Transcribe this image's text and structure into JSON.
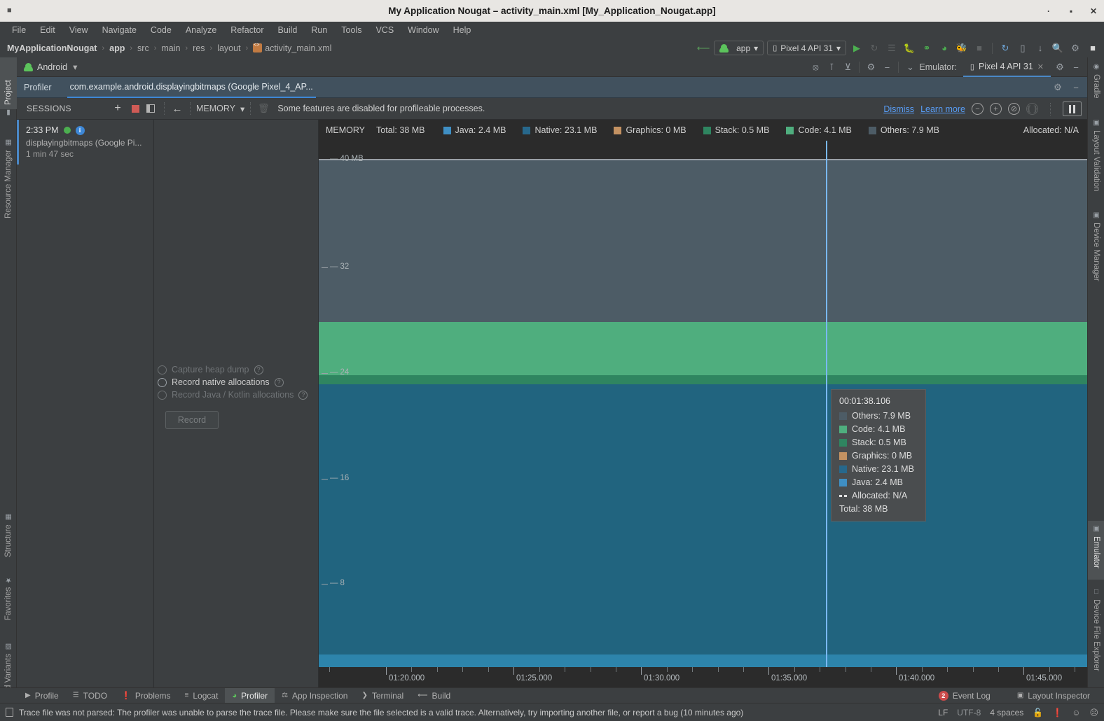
{
  "window": {
    "title": "My Application Nougat – activity_main.xml [My_Application_Nougat.app]",
    "minimize": "·",
    "maximize": "▪",
    "close": "✕"
  },
  "menubar": {
    "items": [
      "File",
      "Edit",
      "View",
      "Navigate",
      "Code",
      "Analyze",
      "Refactor",
      "Build",
      "Run",
      "Tools",
      "VCS",
      "Window",
      "Help"
    ]
  },
  "breadcrumb": {
    "items": [
      "MyApplicationNougat",
      "app",
      "src",
      "main",
      "res",
      "layout",
      "activity_main.xml"
    ],
    "separator": "›"
  },
  "run_toolbar": {
    "module_label": "app",
    "device_label": "Pixel 4 API 31",
    "icons": [
      "hammer-icon",
      "run-icon",
      "run-coverage-icon",
      "profile-icon",
      "debug-icon",
      "attach-debugger-icon",
      "profiler-icon",
      "run-with-android-icon",
      "stop-icon",
      "sync-gradle-icon",
      "avd-manager-icon",
      "sdk-manager-icon",
      "search-icon",
      "settings-icon",
      "account-icon"
    ]
  },
  "left_strip": {
    "items": [
      "Project",
      "Resource Manager",
      "Structure",
      "Favorites",
      "Build Variants"
    ],
    "selected": "Project"
  },
  "right_strip": {
    "items": [
      "Gradle",
      "Layout Validation",
      "Device Manager",
      "Emulator",
      "Device File Explorer"
    ],
    "selected": "Emulator"
  },
  "tool_window": {
    "android_label": "Android",
    "emulator_label": "Emulator:",
    "emulator_tab": "Pixel 4 API 31",
    "close_tab": "✕",
    "icons": [
      "target-icon",
      "collapse-icon",
      "expand-icon",
      "gear-icon",
      "minimize-icon",
      "chevron-down-icon"
    ]
  },
  "profiler_tabs": {
    "panel_label": "Profiler",
    "active_tab": "com.example.android.displayingbitmaps (Google Pixel_4_AP...",
    "gear": "gear-icon",
    "minimize": "minimize-icon"
  },
  "sessions_bar": {
    "title": "SESSIONS",
    "add_label": "+",
    "stop_label": "stop-session-icon",
    "panel_label": "toggle-panel-icon",
    "back_label": "←",
    "stage_label": "MEMORY",
    "stage_caret": "▾",
    "trash_label": "trash-icon",
    "notice": "Some features are disabled for profileable processes.",
    "dismiss": "Dismiss",
    "learn_more": "Learn more",
    "zoom_out": "−",
    "zoom_in": "+",
    "reset_zoom": "reset-zoom-icon",
    "attach_live": "attach-to-live-icon",
    "pause": "pause-icon"
  },
  "session": {
    "time": "2:33 PM",
    "name": "displayingbitmaps (Google Pi...",
    "duration": "1 min 47 sec"
  },
  "record_options": {
    "options": [
      {
        "label": "Capture heap dump",
        "enabled": false,
        "help": "?"
      },
      {
        "label": "Record native allocations",
        "enabled": true,
        "help": "?"
      },
      {
        "label": "Record Java / Kotlin allocations",
        "enabled": false,
        "help": "?"
      }
    ],
    "record_button": "Record"
  },
  "chart_data": {
    "type": "area",
    "title": "MEMORY",
    "total_label": "Total: 38 MB",
    "allocated_label": "Allocated: N/A",
    "legend_position": "top",
    "legend": [
      {
        "name": "Java",
        "value": "2.4 MB",
        "color": "#3f8fc4"
      },
      {
        "name": "Native",
        "value": "23.1 MB",
        "color": "#27688c"
      },
      {
        "name": "Graphics",
        "value": "0 MB",
        "color": "#c49262"
      },
      {
        "name": "Stack",
        "value": "0.5 MB",
        "color": "#2f8560"
      },
      {
        "name": "Code",
        "value": "4.1 MB",
        "color": "#4fae7e"
      },
      {
        "name": "Others",
        "value": "7.9 MB",
        "color": "#4d5c66"
      }
    ],
    "ylabel": "MB",
    "ylim": [
      0,
      40
    ],
    "yticks": [
      {
        "value": 40,
        "label": "40 MB"
      },
      {
        "value": 32,
        "label": "32"
      },
      {
        "value": 24,
        "label": "24"
      },
      {
        "value": 16,
        "label": "16"
      },
      {
        "value": 8,
        "label": "8"
      }
    ],
    "xlabel": "",
    "xticks": [
      "01:20.000",
      "01:25.000",
      "01:30.000",
      "01:35.000",
      "01:40.000",
      "01:45.000"
    ],
    "xlim": [
      "01:17.5",
      "01:47.5"
    ],
    "grid": false,
    "series": [
      {
        "name": "Java",
        "value_mb": 2.4,
        "color": "#3080ab"
      },
      {
        "name": "Native",
        "value_mb": 23.1,
        "color": "#21647f"
      },
      {
        "name": "Graphics",
        "value_mb": 0,
        "color": "#c49262"
      },
      {
        "name": "Stack",
        "value_mb": 0.5,
        "color": "#2f8560"
      },
      {
        "name": "Code",
        "value_mb": 4.1,
        "color": "#4fae7e"
      },
      {
        "name": "Others",
        "value_mb": 7.9,
        "color": "#4d5c66"
      }
    ],
    "cursor_time": "00:01:38.106"
  },
  "tooltip": {
    "time": "00:01:38.106",
    "rows": [
      {
        "label": "Others: 7.9 MB",
        "color": "#4d5c66",
        "swatch": "square"
      },
      {
        "label": "Code: 4.1 MB",
        "color": "#4fae7e",
        "swatch": "square"
      },
      {
        "label": "Stack: 0.5 MB",
        "color": "#2f8560",
        "swatch": "square"
      },
      {
        "label": "Graphics: 0 MB",
        "color": "#c49262",
        "swatch": "square"
      },
      {
        "label": "Native: 23.1 MB",
        "color": "#27688c",
        "swatch": "square"
      },
      {
        "label": "Java: 2.4 MB",
        "color": "#3f8fc4",
        "swatch": "square"
      },
      {
        "label": "Allocated: N/A",
        "color": "#e0e0e0",
        "swatch": "dash"
      }
    ],
    "total": "Total: 38 MB"
  },
  "bottom_bar": {
    "tabs": [
      {
        "label": "Profile",
        "icon": "play-icon",
        "selected": false
      },
      {
        "label": "TODO",
        "icon": "list-icon",
        "selected": false
      },
      {
        "label": "Problems",
        "icon": "warning-icon",
        "selected": false
      },
      {
        "label": "Logcat",
        "icon": "logcat-icon",
        "selected": false
      },
      {
        "label": "Profiler",
        "icon": "profiler-icon",
        "selected": true
      },
      {
        "label": "App Inspection",
        "icon": "inspection-icon",
        "selected": false
      },
      {
        "label": "Terminal",
        "icon": "terminal-icon",
        "selected": false
      },
      {
        "label": "Build",
        "icon": "build-icon",
        "selected": false
      }
    ],
    "event_log": {
      "label": "Event Log",
      "count": "2"
    },
    "layout_inspector": {
      "label": "Layout Inspector",
      "icon": "layout-inspector-icon"
    }
  },
  "status_bar": {
    "message": "Trace file was not parsed: The profiler was unable to parse the trace file. Please make sure the file selected is a valid trace. Alternatively, try importing another file, or report a bug (10 minutes ago)",
    "line_sep": "LF",
    "encoding": "UTF-8",
    "indent": "4 spaces",
    "lock_icon": "lock-icon",
    "error_icon": "error-icon",
    "happy_icon": "☺",
    "sad_icon": "☹"
  }
}
